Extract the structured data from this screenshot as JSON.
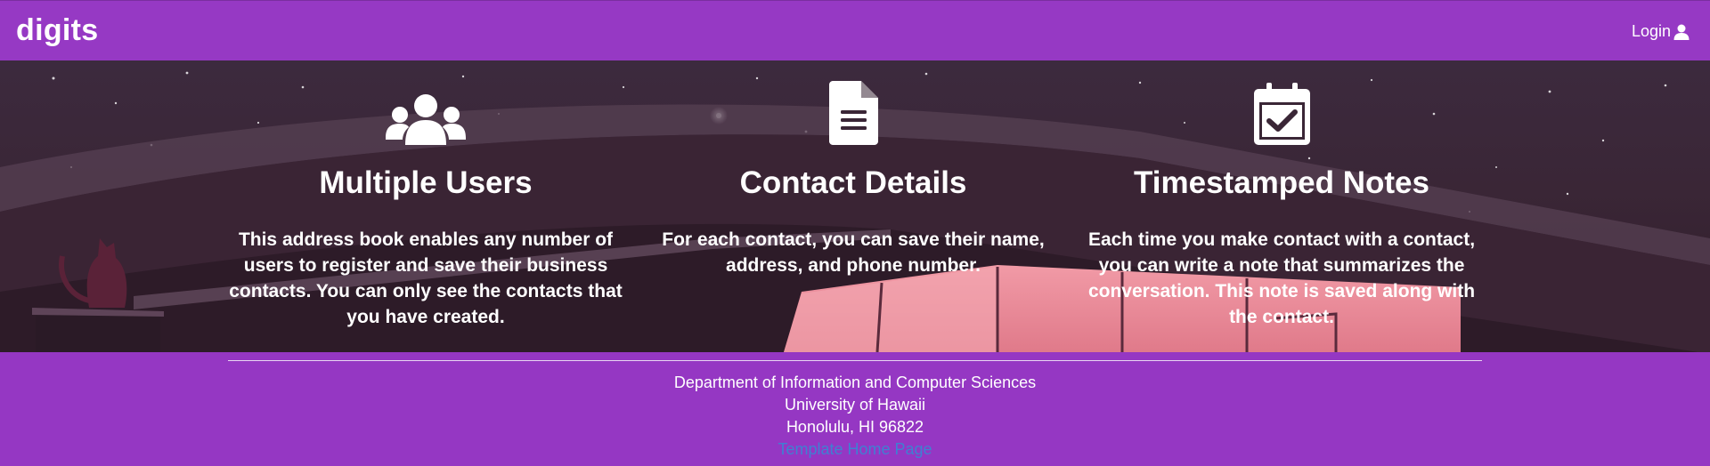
{
  "navbar": {
    "brand": "digits",
    "login_label": "Login"
  },
  "features": [
    {
      "icon": "users-icon",
      "title": "Multiple Users",
      "text": "This address book enables any number of users to register and save their business contacts. You can only see the contacts that you have created."
    },
    {
      "icon": "file-alt-icon",
      "title": "Contact Details",
      "text": "For each contact, you can save their name, address, and phone number."
    },
    {
      "icon": "calendar-check-icon",
      "title": "Timestamped Notes",
      "text": "Each time you make contact with a contact, you can write a note that summarizes the conversation. This note is saved along with the contact."
    }
  ],
  "footer": {
    "line1": "Department of Information and Computer Sciences",
    "line2": "University of Hawaii",
    "line3": "Honolulu, HI 96822",
    "link": "Template Home Page"
  },
  "colors": {
    "purple": "#9537c3",
    "link": "#3f80d2"
  }
}
